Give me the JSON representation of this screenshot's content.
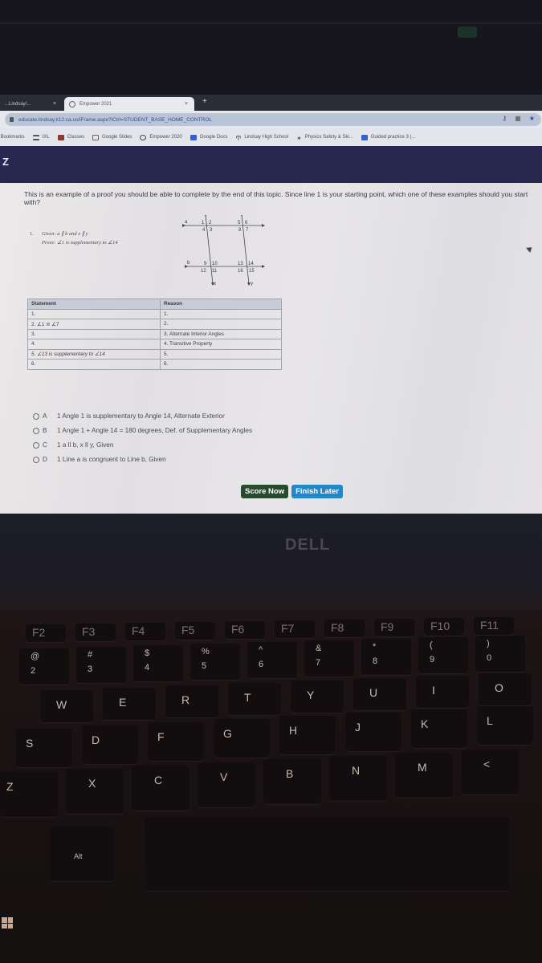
{
  "browser": {
    "tabs": [
      {
        "label": "...Lindsay/...",
        "active": false
      },
      {
        "label": "Empower 2021",
        "active": true
      }
    ],
    "new_tab": "+",
    "close": "×",
    "url": "educate.lindsay.k12.ca.us/iFrame.aspx?iCtrl=STUDENT_BASE_HOME_CONTROL",
    "address_icons": [
      "key-icon",
      "extension-icon",
      "star-icon"
    ],
    "bookmarks": [
      {
        "label": "y Bookmarks",
        "icon": "none",
        "color": ""
      },
      {
        "label": "IXL",
        "icon": "ixl-icon",
        "color": "#555"
      },
      {
        "label": "Classes",
        "icon": "classroom-icon",
        "color": "#8b3a3a"
      },
      {
        "label": "Google Slides",
        "icon": "slides-icon",
        "color": "#666"
      },
      {
        "label": "Empower 2020",
        "icon": "empower-icon",
        "color": "#444"
      },
      {
        "label": "Google Docs",
        "icon": "docs-icon",
        "color": "#3a5fc4"
      },
      {
        "label": "Lindsay High School",
        "icon": "school-icon",
        "color": "#444"
      },
      {
        "label": "Physics Safety & Ski...",
        "icon": "physics-icon",
        "color": "#444"
      },
      {
        "label": "Guided practice 3 (...",
        "icon": "docs-icon",
        "color": "#3a5fc4"
      }
    ]
  },
  "app": {
    "logo": "Z"
  },
  "question": {
    "prompt": "This is an example of a proof you should be able to complete by the end of this topic. Since line 1 is your starting point, which one of these examples should you start with?",
    "problem_number": "1.",
    "given": "Given: a ∥ b and x ∥ y",
    "prove": "Prove: ∠1 is supplementary to ∠14",
    "diagram": {
      "lines": [
        "a",
        "b",
        "x",
        "y"
      ],
      "angles_top_left": [
        "1",
        "2",
        "4",
        "3"
      ],
      "angles_top_right": [
        "5",
        "6",
        "8",
        "7"
      ],
      "angles_bottom_left": [
        "9",
        "10",
        "12",
        "11"
      ],
      "angles_bottom_right": [
        "13",
        "14",
        "16",
        "15"
      ]
    },
    "table": {
      "headers": [
        "Statement",
        "Reason"
      ],
      "rows": [
        [
          "1.",
          "1."
        ],
        [
          "2. ∠1 ≅ ∠7",
          "2."
        ],
        [
          "3.",
          "3. Alternate Interior Angles"
        ],
        [
          "4.",
          "4. Transitive Property"
        ],
        [
          "5. ∠13 is supplementary to ∠14",
          "5."
        ],
        [
          "6.",
          "6."
        ]
      ]
    },
    "options": [
      {
        "letter": "A",
        "text": "1  Angle 1 is supplementary to Angle 14, Alternate Exterior"
      },
      {
        "letter": "B",
        "text": "1  Angle 1 + Angle 14 = 180 degrees,  Def. of Supplementary Angles"
      },
      {
        "letter": "C",
        "text": "1  a ll b, x ll y,  Given"
      },
      {
        "letter": "D",
        "text": "1  Line a is congruent to Line b,  Given"
      }
    ],
    "buttons": {
      "score": "Score Now",
      "later": "Finish Later"
    },
    "colors": {
      "score_button": "#2a4a30",
      "later_button": "#2487c8",
      "header": "#272750"
    }
  },
  "laptop": {
    "brand": "DELL",
    "keys": {
      "fn_row": [
        "F2",
        "F3",
        "F4",
        "F5",
        "F6",
        "F7",
        "F8",
        "F9",
        "F10",
        "F11"
      ],
      "number_row": [
        {
          "top": "@",
          "main": "2"
        },
        {
          "top": "#",
          "main": "3"
        },
        {
          "top": "$",
          "main": "4"
        },
        {
          "top": "%",
          "main": "5"
        },
        {
          "top": "^",
          "main": "6"
        },
        {
          "top": "&",
          "main": "7"
        },
        {
          "top": "*",
          "main": "8"
        },
        {
          "top": "(",
          "main": "9"
        },
        {
          "top": ")",
          "main": "0"
        }
      ],
      "qwerty_row": [
        "W",
        "E",
        "R",
        "T",
        "Y",
        "U",
        "I",
        "O"
      ],
      "home_row": [
        "S",
        "D",
        "F",
        "G",
        "H",
        "J",
        "K",
        "L"
      ],
      "bottom_row": [
        "Z",
        "X",
        "C",
        "V",
        "B",
        "N",
        "M",
        "<"
      ],
      "modifier": "Alt"
    }
  }
}
